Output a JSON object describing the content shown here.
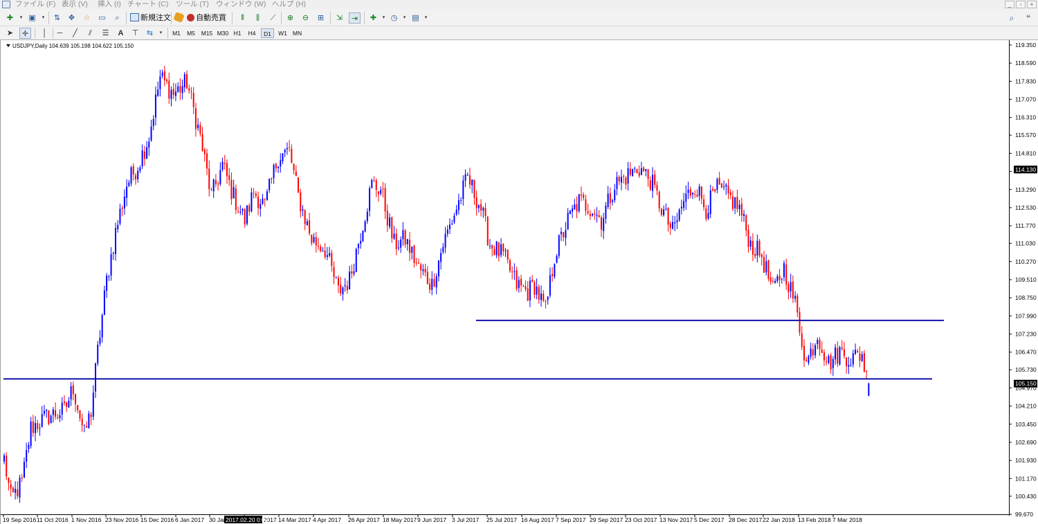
{
  "menu": {
    "items": [
      "ファイル (F)",
      "表示 (V)",
      "挿入 (I)",
      "チャート (C)",
      "ツール (T)",
      "ウィンドウ (W)",
      "ヘルプ (H)"
    ]
  },
  "window_controls": [
    "_",
    "▫",
    "×"
  ],
  "toolbar": {
    "new_order_label": "新規注文",
    "auto_trade_label": "自動売買",
    "icons": [
      "new-chart-icon",
      "profiles-icon",
      "market-watch-icon",
      "navigator-icon",
      "data-window-icon",
      "terminal-icon",
      "tester-icon",
      "bar-chart-icon",
      "candlestick-icon",
      "line-chart-icon",
      "zoom-in-icon",
      "zoom-out-icon",
      "tile-windows-icon",
      "auto-scroll-icon",
      "chart-shift-icon",
      "indicators-icon",
      "periods-icon",
      "templates-icon",
      "search-icon",
      "chat-icon"
    ]
  },
  "drawing_tools": {
    "icons": [
      "cursor-icon",
      "crosshair-icon",
      "vertical-line-icon",
      "horizontal-line-icon",
      "trendline-icon",
      "equidistant-channel-icon",
      "fibonacci-icon",
      "text-icon",
      "text-label-icon",
      "arrows-icon"
    ],
    "text_tool": "A"
  },
  "timeframes": {
    "items": [
      "M1",
      "M5",
      "M15",
      "M30",
      "H1",
      "H4",
      "D1",
      "W1",
      "MN"
    ],
    "active": "D1"
  },
  "chart": {
    "symbol_info": "USDJPY,Daily  104.639 105.198 104.622 105.150",
    "cursor_time_label": "2017.02.20 0:00"
  },
  "chart_data": {
    "type": "candlestick",
    "symbol": "USDJPY",
    "timeframe": "Daily",
    "ohlc_last": {
      "open": 104.639,
      "high": 105.198,
      "low": 104.622,
      "close": 105.15
    },
    "ylim": [
      99.67,
      119.35
    ],
    "y_ticks": [
      "119.350",
      "118.590",
      "117.830",
      "117.070",
      "116.310",
      "115.570",
      "114.810",
      "114.050",
      "113.290",
      "112.530",
      "111.770",
      "111.030",
      "110.270",
      "109.510",
      "108.750",
      "107.990",
      "107.230",
      "106.470",
      "105.730",
      "104.970",
      "104.210",
      "103.450",
      "102.690",
      "101.930",
      "101.170",
      "100.430",
      "99.670"
    ],
    "x_ticks": [
      "19 Sep 2016",
      "11 Oct 2016",
      "1 Nov 2016",
      "23 Nov 2016",
      "15 Dec 2016",
      "6 Jan 2017",
      "30 Jan 2017",
      "21 Feb 2017",
      "14 Mar 2017",
      "4 Apr 2017",
      "26 Apr 2017",
      "18 May 2017",
      "9 Jun 2017",
      "3 Jul 2017",
      "25 Jul 2017",
      "16 Aug 2017",
      "7 Sep 2017",
      "29 Sep 2017",
      "23 Oct 2017",
      "13 Nov 2017",
      "5 Dec 2017",
      "28 Dec 2017",
      "22 Jan 2018",
      "13 Feb 2018",
      "7 Mar 2018"
    ],
    "price_labels": [
      {
        "label": "114.130",
        "value": 114.13
      },
      {
        "label": "105.150",
        "value": 105.15
      }
    ],
    "anchors": [
      {
        "i": 0,
        "p": 102.0
      },
      {
        "i": 3,
        "p": 100.3
      },
      {
        "i": 8,
        "p": 101.0
      },
      {
        "i": 12,
        "p": 103.3
      },
      {
        "i": 20,
        "p": 103.8
      },
      {
        "i": 27,
        "p": 104.0
      },
      {
        "i": 31,
        "p": 105.0
      },
      {
        "i": 36,
        "p": 103.0
      },
      {
        "i": 39,
        "p": 104.0
      },
      {
        "i": 42,
        "p": 106.5
      },
      {
        "i": 46,
        "p": 109.5
      },
      {
        "i": 50,
        "p": 111.5
      },
      {
        "i": 55,
        "p": 113.5
      },
      {
        "i": 60,
        "p": 114.3
      },
      {
        "i": 65,
        "p": 115.5
      },
      {
        "i": 70,
        "p": 118.0
      },
      {
        "i": 76,
        "p": 117.3
      },
      {
        "i": 82,
        "p": 117.8
      },
      {
        "i": 88,
        "p": 115.5
      },
      {
        "i": 93,
        "p": 113.0
      },
      {
        "i": 98,
        "p": 114.3
      },
      {
        "i": 103,
        "p": 113.0
      },
      {
        "i": 108,
        "p": 112.0
      },
      {
        "i": 112,
        "p": 113.2
      },
      {
        "i": 117,
        "p": 112.6
      },
      {
        "i": 123,
        "p": 114.7
      },
      {
        "i": 128,
        "p": 114.9
      },
      {
        "i": 132,
        "p": 113.0
      },
      {
        "i": 138,
        "p": 111.2
      },
      {
        "i": 144,
        "p": 110.8
      },
      {
        "i": 150,
        "p": 109.0
      },
      {
        "i": 155,
        "p": 109.5
      },
      {
        "i": 160,
        "p": 111.5
      },
      {
        "i": 165,
        "p": 113.5
      },
      {
        "i": 169,
        "p": 113.3
      },
      {
        "i": 175,
        "p": 111.0
      },
      {
        "i": 180,
        "p": 111.2
      },
      {
        "i": 186,
        "p": 110.0
      },
      {
        "i": 192,
        "p": 109.3
      },
      {
        "i": 197,
        "p": 111.0
      },
      {
        "i": 203,
        "p": 112.5
      },
      {
        "i": 208,
        "p": 113.8
      },
      {
        "i": 214,
        "p": 112.5
      },
      {
        "i": 218,
        "p": 111.0
      },
      {
        "i": 224,
        "p": 110.5
      },
      {
        "i": 230,
        "p": 109.3
      },
      {
        "i": 235,
        "p": 109.0
      },
      {
        "i": 238,
        "p": 109.3
      },
      {
        "i": 243,
        "p": 108.2
      },
      {
        "i": 247,
        "p": 110.5
      },
      {
        "i": 253,
        "p": 112.0
      },
      {
        "i": 258,
        "p": 112.8
      },
      {
        "i": 264,
        "p": 112.5
      },
      {
        "i": 268,
        "p": 112.0
      },
      {
        "i": 274,
        "p": 113.5
      },
      {
        "i": 280,
        "p": 113.9
      },
      {
        "i": 285,
        "p": 114.2
      },
      {
        "i": 290,
        "p": 113.7
      },
      {
        "i": 295,
        "p": 112.5
      },
      {
        "i": 300,
        "p": 111.5
      },
      {
        "i": 305,
        "p": 112.8
      },
      {
        "i": 310,
        "p": 113.5
      },
      {
        "i": 315,
        "p": 112.5
      },
      {
        "i": 320,
        "p": 113.3
      },
      {
        "i": 325,
        "p": 113.0
      },
      {
        "i": 330,
        "p": 112.5
      },
      {
        "i": 335,
        "p": 111.0
      },
      {
        "i": 340,
        "p": 110.5
      },
      {
        "i": 345,
        "p": 109.0
      },
      {
        "i": 350,
        "p": 110.0
      },
      {
        "i": 355,
        "p": 108.5
      },
      {
        "i": 360,
        "p": 106.0
      },
      {
        "i": 365,
        "p": 107.2
      },
      {
        "i": 370,
        "p": 106.0
      },
      {
        "i": 375,
        "p": 106.5
      },
      {
        "i": 380,
        "p": 106.2
      },
      {
        "i": 385,
        "p": 106.4
      },
      {
        "i": 387,
        "p": 105.4
      },
      {
        "i": 388,
        "p": 105.15
      }
    ],
    "horizontal_lines": [
      {
        "price": 107.8,
        "color": "#1010a8"
      },
      {
        "price": 105.35,
        "color": "#1010a8"
      }
    ],
    "bull_color": "#0000ff",
    "bear_color": "#ff0000",
    "axis_color": "#000000"
  }
}
